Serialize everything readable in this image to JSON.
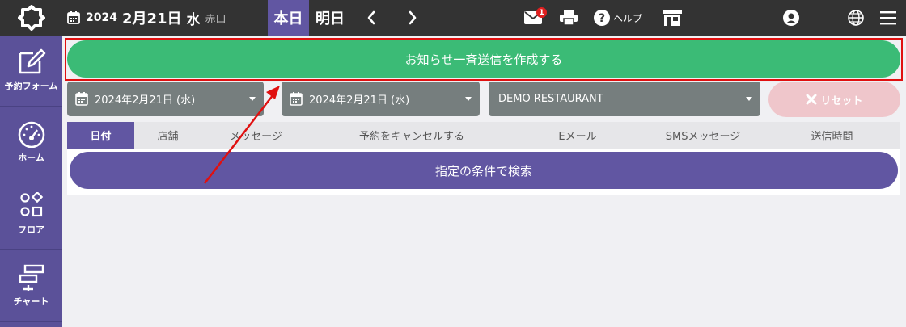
{
  "header": {
    "year": "2024",
    "month_day": "2月21日",
    "weekday": "水",
    "rokuyo": "赤口",
    "today_label": "本日",
    "tomorrow_label": "明日",
    "mail_badge": "1",
    "help_label": "ヘルプ"
  },
  "sidebar": {
    "items": [
      {
        "label": "予約フォーム",
        "icon": "edit-icon"
      },
      {
        "label": "ホーム",
        "icon": "gauge-icon"
      },
      {
        "label": "フロア",
        "icon": "shapes-icon"
      },
      {
        "label": "チャート",
        "icon": "chart-icon"
      }
    ]
  },
  "main": {
    "create_button": "お知らせ一斉送信を作成する",
    "date_from": "2024年2月21日 (水)",
    "date_to": "2024年2月21日 (水)",
    "restaurant": "DEMO RESTAURANT",
    "reset_label": "リセット",
    "tabs": [
      "日付",
      "店舗",
      "メッセージ",
      "予約をキャンセルする",
      "Eメール",
      "SMSメッセージ",
      "送信時間"
    ],
    "search_button": "指定の条件で検索"
  },
  "colors": {
    "topbar": "#333333",
    "accent": "#6156a2",
    "sidebar": "#5b5199",
    "green": "#3bbb76",
    "select_grey": "#767e7e",
    "reset_pink": "#efc6cb",
    "annotation_red": "#e01010"
  }
}
